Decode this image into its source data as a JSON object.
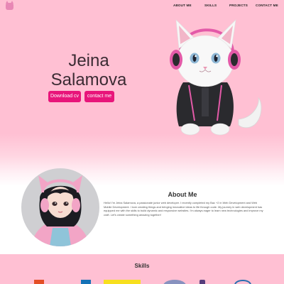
{
  "nav": {
    "items": [
      {
        "label": "ABOUT ME"
      },
      {
        "label": "SKILLS"
      },
      {
        "label": "PROJECTS"
      },
      {
        "label": "CONTACT ME"
      }
    ]
  },
  "hero": {
    "first_name": "Jeina",
    "last_name": "Salamova",
    "download_label": "Download cv",
    "contact_label": "contact me"
  },
  "about": {
    "title": "About Me",
    "text": "Hello! I'm Jeina Salamova, a passionate junior web developer. I recently completed my Bac +2 in Web Development and Web Mobile Development. I love creating things and bringing innovative ideas to life through code. My journey in web development has equipped me with the skills to build dynamic and responsive websites. I'm always eager to learn new technologies and improve my craft. Let's create something amazing together!"
  },
  "skills": {
    "title": "Skills"
  },
  "colors": {
    "hero_bg": "#ffc0d3",
    "accent": "#e8157a",
    "headphones": "#e35aa8"
  }
}
